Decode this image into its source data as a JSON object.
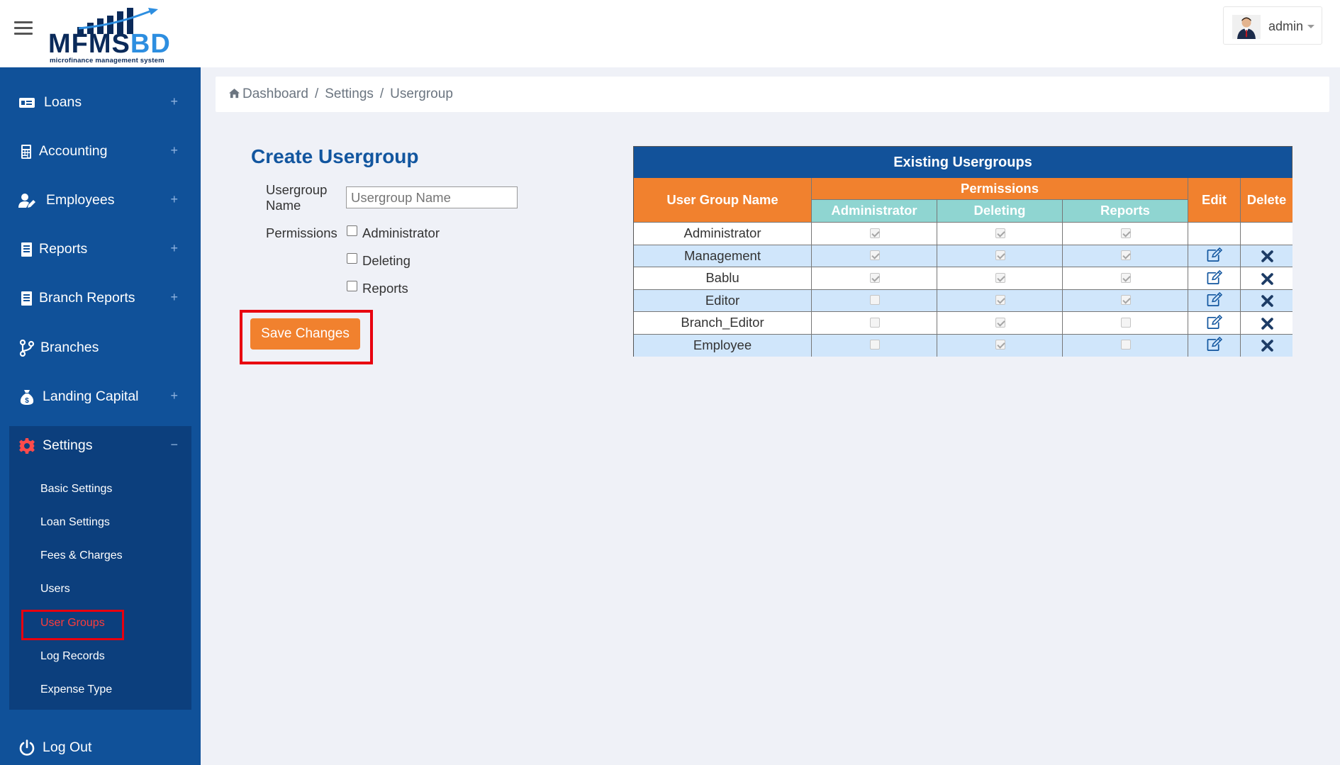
{
  "header": {
    "logo_text": "MFMS",
    "logo_text_accent": "BD",
    "logo_tagline": "microfinance management system",
    "user_name": "admin"
  },
  "sidebar": {
    "items": [
      {
        "label": "Loans",
        "icon": "money-card-icon",
        "expand": "+"
      },
      {
        "label": "Accounting",
        "icon": "calculator-icon",
        "expand": "+"
      },
      {
        "label": "Employees",
        "icon": "user-edit-icon",
        "expand": "+"
      },
      {
        "label": "Reports",
        "icon": "document-icon",
        "expand": "+"
      },
      {
        "label": "Branch Reports",
        "icon": "document-icon",
        "expand": "+"
      },
      {
        "label": "Branches",
        "icon": "code-branch-icon",
        "expand": ""
      },
      {
        "label": "Landing Capital",
        "icon": "money-bag-icon",
        "expand": "+"
      },
      {
        "label": "Settings",
        "icon": "gear-icon",
        "expand": "−"
      }
    ],
    "settings_sub": [
      {
        "label": "Basic Settings",
        "active": false
      },
      {
        "label": "Loan Settings",
        "active": false
      },
      {
        "label": "Fees & Charges",
        "active": false
      },
      {
        "label": "Users",
        "active": false
      },
      {
        "label": "User Groups",
        "active": true
      },
      {
        "label": "Log Records",
        "active": false
      },
      {
        "label": "Expense Type",
        "active": false
      }
    ],
    "logout_label": "Log Out"
  },
  "breadcrumb": {
    "home": "Dashboard",
    "settings": "Settings",
    "current": "Usergroup",
    "separator": "/"
  },
  "form": {
    "title": "Create Usergroup",
    "name_label_line1": "Usergroup",
    "name_label_line2": "Name",
    "name_placeholder": "Usergroup Name",
    "name_value": "",
    "permissions_label": "Permissions",
    "permissions": [
      {
        "label": "Administrator",
        "checked": false
      },
      {
        "label": "Deleting",
        "checked": false
      },
      {
        "label": "Reports",
        "checked": false
      }
    ],
    "save_label": "Save Changes"
  },
  "table": {
    "title": "Existing Usergroups",
    "col_name": "User Group Name",
    "col_permissions": "Permissions",
    "col_admin": "Administrator",
    "col_deleting": "Deleting",
    "col_reports": "Reports",
    "col_edit": "Edit",
    "col_delete": "Delete",
    "rows": [
      {
        "name": "Administrator",
        "admin": true,
        "deleting": true,
        "reports": true,
        "actions": false
      },
      {
        "name": "Management",
        "admin": true,
        "deleting": true,
        "reports": true,
        "actions": true
      },
      {
        "name": "Bablu",
        "admin": true,
        "deleting": true,
        "reports": true,
        "actions": true
      },
      {
        "name": "Editor",
        "admin": false,
        "deleting": true,
        "reports": true,
        "actions": true
      },
      {
        "name": "Branch_Editor",
        "admin": false,
        "deleting": true,
        "reports": false,
        "actions": true
      },
      {
        "name": "Employee",
        "admin": false,
        "deleting": true,
        "reports": false,
        "actions": true
      }
    ]
  },
  "colors": {
    "sidebar": "#105199",
    "sidebar_sub": "#0c3f7d",
    "accent_orange": "#f1812e",
    "table_title": "#12529a",
    "sub_header": "#8fd5d1",
    "row_highlight": "#d0e6fb",
    "highlight_red": "#e8000f"
  }
}
